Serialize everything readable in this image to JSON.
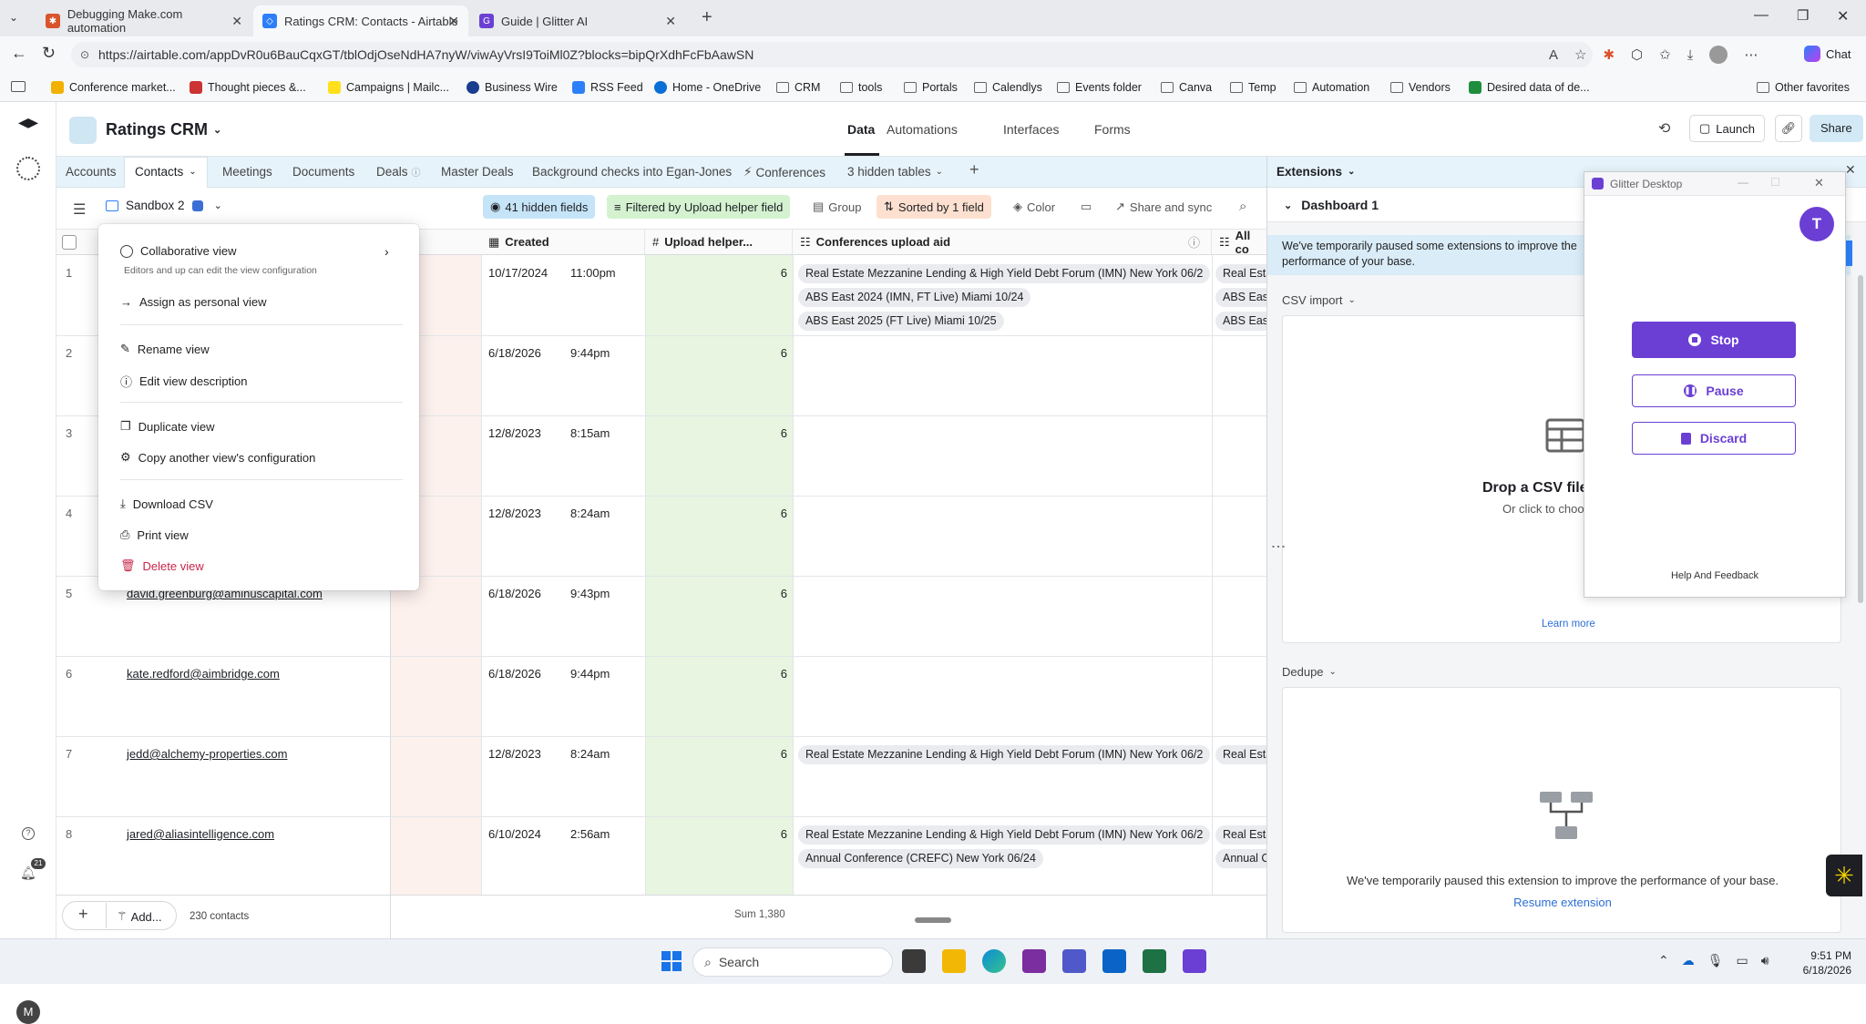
{
  "browser": {
    "tabs": [
      {
        "title": "Debugging Make.com automation",
        "favicon_color": "#d9532c"
      },
      {
        "title": "Ratings CRM: Contacts - Airtable",
        "favicon_color": "#2d7ff9"
      },
      {
        "title": "Guide | Glitter AI",
        "favicon_color": "#6b3fd4"
      }
    ],
    "url": "https://airtable.com/appDvR0u6BauCqxGT/tblOdjOseNdHA7nyW/viwAyVrsI9ToiMl0Z?blocks=bipQrXdhFcFbAawSN",
    "chat_label": "Chat",
    "bookmarks": [
      "Conference market...",
      "Thought pieces &...",
      "Campaigns | Mailc...",
      "Business Wire",
      "RSS Feed",
      "Home - OneDrive",
      "CRM",
      "tools",
      "Portals",
      "Calendlys",
      "Events folder",
      "Canva",
      "Temp",
      "Automation",
      "Vendors",
      "Desired data of de..."
    ],
    "other_favorites": "Other favorites"
  },
  "app": {
    "base_name": "Ratings CRM",
    "nav": [
      "Data",
      "Automations",
      "Interfaces",
      "Forms"
    ],
    "launch_label": "Launch",
    "share_label": "Share",
    "notification_count": "21",
    "user_initial": "M"
  },
  "tables": [
    "Accounts",
    "Contacts",
    "Meetings",
    "Documents",
    "Deals",
    "Master Deals",
    "Background checks into Egan-Jones",
    "Conferences",
    "3 hidden tables"
  ],
  "viewbar": {
    "view_name": "Sandbox 2",
    "hidden_fields": "41 hidden fields",
    "filter": "Filtered by Upload helper field",
    "group": "Group",
    "sorted": "Sorted by 1 field",
    "color": "Color",
    "share_sync": "Share and sync"
  },
  "grid": {
    "headers": [
      "Created",
      "Upload helper...",
      "Conferences upload aid",
      "All co"
    ],
    "rows": [
      {
        "num": "1",
        "email": "",
        "date": "10/17/2024",
        "time": "11:00pm",
        "helper": "6",
        "chips": [
          "Real Estate Mezzanine Lending & High Yield Debt Forum (IMN) New York 06/2",
          "ABS East 2024 (IMN, FT Live) Miami 10/24",
          "ABS East 2025 (FT Live) Miami 10/25"
        ],
        "allco": [
          "Real Esta",
          "ABS East",
          "ABS East"
        ]
      },
      {
        "num": "2",
        "email": "",
        "date": "6/18/2026",
        "time": "9:44pm",
        "helper": "6",
        "chips": [],
        "allco": []
      },
      {
        "num": "3",
        "email": "",
        "date": "12/8/2023",
        "time": "8:15am",
        "helper": "6",
        "chips": [],
        "allco": []
      },
      {
        "num": "4",
        "email": "",
        "date": "12/8/2023",
        "time": "8:24am",
        "helper": "6",
        "chips": [],
        "allco": []
      },
      {
        "num": "5",
        "email": "david.greenburg@aminuscapital.com",
        "date": "6/18/2026",
        "time": "9:43pm",
        "helper": "6",
        "chips": [],
        "allco": []
      },
      {
        "num": "6",
        "email": "kate.redford@aimbridge.com",
        "date": "6/18/2026",
        "time": "9:44pm",
        "helper": "6",
        "chips": [],
        "allco": []
      },
      {
        "num": "7",
        "email": "jedd@alchemy-properties.com",
        "date": "12/8/2023",
        "time": "8:24am",
        "helper": "6",
        "chips": [
          "Real Estate Mezzanine Lending & High Yield Debt Forum (IMN) New York 06/2"
        ],
        "allco": [
          "Real Esta"
        ]
      },
      {
        "num": "8",
        "email": "jared@aliasintelligence.com",
        "date": "6/10/2024",
        "time": "2:56am",
        "helper": "6",
        "chips": [
          "Real Estate Mezzanine Lending & High Yield Debt Forum (IMN) New York 06/2",
          "Annual Conference (CREFC) New York 06/24"
        ],
        "allco": [
          "Real Esta",
          "Annual C"
        ]
      }
    ],
    "add_label": "Add...",
    "record_count": "230 contacts",
    "sum": "Sum 1,380"
  },
  "menu": {
    "collab_title": "Collaborative view",
    "collab_sub": "Editors and up can edit the view configuration",
    "items": [
      "Assign as personal view",
      "Rename view",
      "Edit view description",
      "Duplicate view",
      "Copy another view's configuration",
      "Download CSV",
      "Print view",
      "Delete view"
    ]
  },
  "extensions": {
    "title": "Extensions",
    "dashboard": "Dashboard 1",
    "paused_msg": "We've temporarily paused some extensions to improve the performance of your base.",
    "csv_title": "CSV import",
    "drop_title": "Drop a CSV file",
    "drop_sub": "Or click to choos",
    "learn_more": "Learn more",
    "dedupe_title": "Dedupe",
    "dedupe_msg": "We've temporarily paused this extension to improve the performance of your base.",
    "resume": "Resume extension"
  },
  "glitter": {
    "title": "Glitter Desktop",
    "avatar": "T",
    "stop": "Stop",
    "pause": "Pause",
    "discard": "Discard",
    "help": "Help And Feedback",
    "accent": "#6b3fd4"
  },
  "taskbar": {
    "search": "Search",
    "time": "9:51 PM",
    "date": "6/18/2026"
  }
}
